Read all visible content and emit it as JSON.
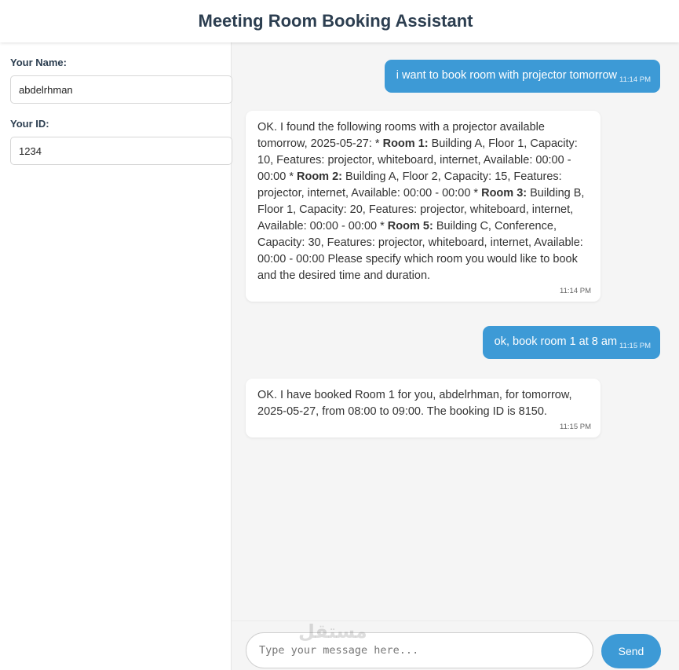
{
  "header": {
    "title": "Meeting Room Booking Assistant"
  },
  "sidebar": {
    "name_label": "Your Name:",
    "name_value": "abdelrhman",
    "id_label": "Your ID:",
    "id_value": "1234"
  },
  "messages": [
    {
      "role": "user",
      "text": "i want to book room with projector tomorrow",
      "time": "11:14 PM"
    },
    {
      "role": "bot",
      "parts": [
        "OK. I found the following rooms with a projector available tomorrow, 2025-05-27: * ",
        "Room 1:",
        " Building A, Floor 1, Capacity: 10, Features: projector, whiteboard, internet, Available: 00:00 - 00:00 * ",
        "Room 2:",
        " Building A, Floor 2, Capacity: 15, Features: projector, internet, Available: 00:00 - 00:00 * ",
        "Room 3:",
        " Building B, Floor 1, Capacity: 20, Features: projector, whiteboard, internet, Available: 00:00 - 00:00 * ",
        "Room 5:",
        " Building C, Conference, Capacity: 30, Features: projector, whiteboard, internet, Available: 00:00 - 00:00 Please specify which room you would like to book and the desired time and duration."
      ],
      "time": "11:14 PM"
    },
    {
      "role": "user",
      "text": "ok, book room 1 at 8 am",
      "time": "11:15 PM"
    },
    {
      "role": "bot",
      "text": "OK. I have booked Room 1 for you, abdelrhman, for tomorrow, 2025-05-27, from 08:00 to 09:00. The booking ID is 8150.",
      "time": "11:15 PM"
    }
  ],
  "composer": {
    "placeholder": "Type your message here...",
    "send_label": "Send"
  },
  "watermark": "مستقل",
  "colors": {
    "accent": "#3d9ad6",
    "title": "#2c3e50"
  }
}
